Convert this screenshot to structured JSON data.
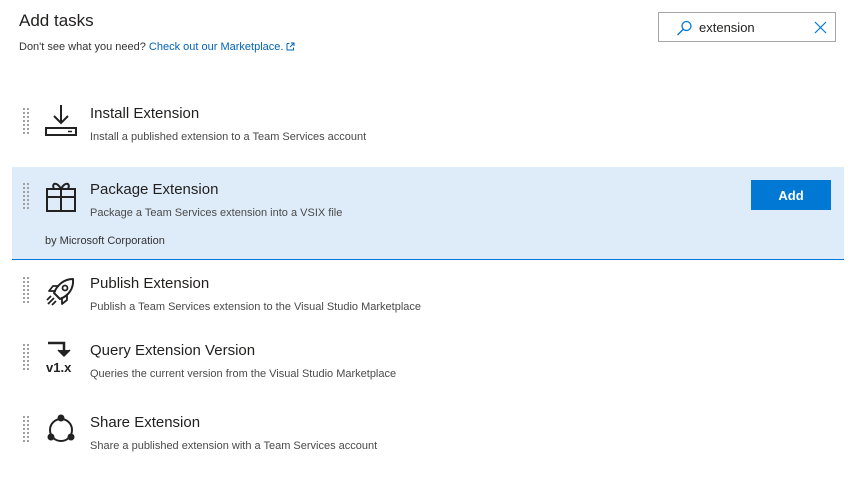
{
  "header": {
    "title": "Add tasks",
    "subtitle_text": "Don't see what you need?",
    "marketplace_link": "Check out our Marketplace."
  },
  "search": {
    "value": "extension",
    "icon": "search-icon",
    "clear_icon": "close-icon"
  },
  "tasks": [
    {
      "name": "Install Extension",
      "description": "Install a published extension to a Team Services account",
      "icon": "download-tray-icon"
    },
    {
      "name": "Package Extension",
      "description": "Package a Team Services extension into a VSIX file",
      "author": "by Microsoft Corporation",
      "icon": "gift-box-icon",
      "selected": true,
      "add_label": "Add"
    },
    {
      "name": "Publish Extension",
      "description": "Publish a Team Services extension to the Visual Studio Marketplace",
      "icon": "rocket-icon"
    },
    {
      "name": "Query Extension Version",
      "description": "Queries the current version from the Visual Studio Marketplace",
      "icon": "version-icon",
      "icon_text": "v1.x"
    },
    {
      "name": "Share Extension",
      "description": "Share a published extension with a Team Services account",
      "icon": "share-icon"
    }
  ],
  "colors": {
    "accent": "#0078d4",
    "selected_bg": "#deecf9",
    "link": "#0064b4"
  }
}
